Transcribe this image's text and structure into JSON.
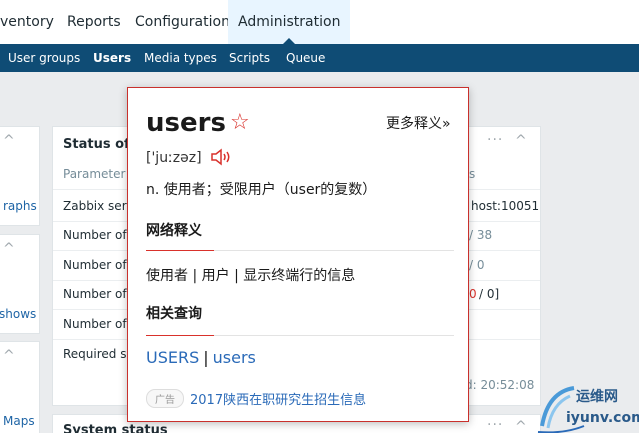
{
  "topnav": {
    "items": [
      "ventory",
      "Reports",
      "Configuration",
      "Administration"
    ],
    "active": "Administration"
  },
  "subnav": {
    "items": [
      "User groups",
      "Users",
      "Media types",
      "Scripts",
      "Queue"
    ],
    "active": "Users"
  },
  "left_widgets": {
    "links": [
      "raphs",
      "shows",
      "Maps"
    ]
  },
  "status_widget": {
    "title": "Status of Z",
    "column_parameter": "Parameter",
    "column_partial": "s",
    "rows": [
      {
        "param": "Zabbix serve",
        "value": "host:10051"
      },
      {
        "param": "Number of h",
        "value": "/ 38"
      },
      {
        "param": "Number of it",
        "value": "/ 0"
      },
      {
        "param": "Number of tr",
        "value_red": "0",
        "value": "/ 0]"
      },
      {
        "param": "Number of u",
        "value": ""
      },
      {
        "param": "Required ser",
        "value": ""
      }
    ],
    "updated": "d: 20:52:08"
  },
  "system_widget": {
    "title": "System status"
  },
  "dictionary": {
    "word": "users",
    "more": "更多释义»",
    "phonetic": "['juːzəz]",
    "definition": "n. 使用者；受限用户（user的复数）",
    "web_section": "网络释义",
    "web_definition": "使用者 | 用户 | 显示终端行的信息",
    "related_section": "相关查询",
    "related_links": [
      "USERS",
      "users"
    ],
    "related_sep": "|",
    "ad_label": "广告",
    "ad_link": "2017陕西在职研究生招生信息"
  },
  "watermark": {
    "line1": "运维网",
    "line2": "iyunv.com"
  },
  "colors": {
    "subnav_bg": "#0f4c75",
    "popup_border": "#c9302c",
    "link": "#2a6ab8"
  }
}
